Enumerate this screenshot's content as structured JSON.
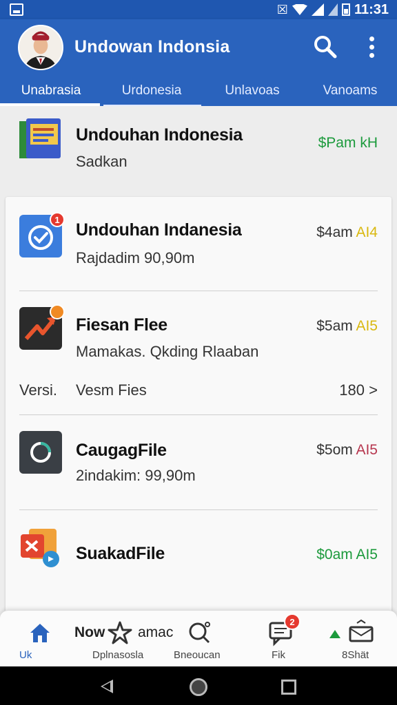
{
  "status_bar": {
    "time": "11:31"
  },
  "app_bar": {
    "title": "Undowan Indonsia",
    "tabs": [
      {
        "label": "Unabrasia",
        "active": true
      },
      {
        "label": "Urdonesia",
        "active": false
      },
      {
        "label": "Unlavoas",
        "active": false
      },
      {
        "label": "Vanoams",
        "active": false
      }
    ]
  },
  "list": {
    "items": [
      {
        "title": "Undouhan Indonesia",
        "subtitle": "Sadkan",
        "meta_a": "$Pam",
        "meta_b": "kH",
        "meta_color": "#1c9a3c",
        "icon": "ebook-icon",
        "badge": ""
      },
      {
        "title": "Undouhan Indanesia",
        "subtitle": "Rajdadim 90,90m",
        "meta_a": "$4am",
        "meta_b": "AI4",
        "meta_color": "#d9b80f",
        "icon": "check-circle-icon",
        "badge": "1"
      },
      {
        "title": "Fiesan Flee",
        "subtitle": "Mamakas. Qkding Rlaaban",
        "meta_a": "$5am",
        "meta_b": "AI5",
        "meta_color": "#d9b80f",
        "icon": "trending-icon",
        "badge": ""
      },
      {
        "title": "CaugagFile",
        "subtitle": "2indakim: 99,90m",
        "meta_a": "$5om",
        "meta_b": "AI5",
        "meta_color": "#b7374f",
        "icon": "circle-ring-icon",
        "badge": ""
      },
      {
        "title": "SuakadFile",
        "subtitle": "",
        "meta_a": "$0am",
        "meta_b": "AI5",
        "meta_color": "#1c9a3c",
        "icon": "office-file-icon",
        "badge": ""
      }
    ],
    "version_row": {
      "label": "Versi.",
      "text": "Vesm Fies",
      "count": "180",
      "arrow": ">"
    }
  },
  "bottom_nav": {
    "items": [
      {
        "label": "Uk",
        "icon": "home-icon",
        "active": true
      },
      {
        "label": "Dplnasosla",
        "icon": "star-icon",
        "overlay": "Now",
        "active": false
      },
      {
        "label": "Bneoucan",
        "icon": "person-search-icon",
        "overlay": "amac",
        "active": false
      },
      {
        "label": "Fik",
        "icon": "message-icon",
        "badge": "2",
        "active": false
      },
      {
        "label": "8Shät",
        "icon": "share-icon",
        "active": false
      }
    ]
  },
  "colors": {
    "primary": "#2a63bd",
    "status_bar": "#1f57b0",
    "badge_red": "#e5392f"
  }
}
